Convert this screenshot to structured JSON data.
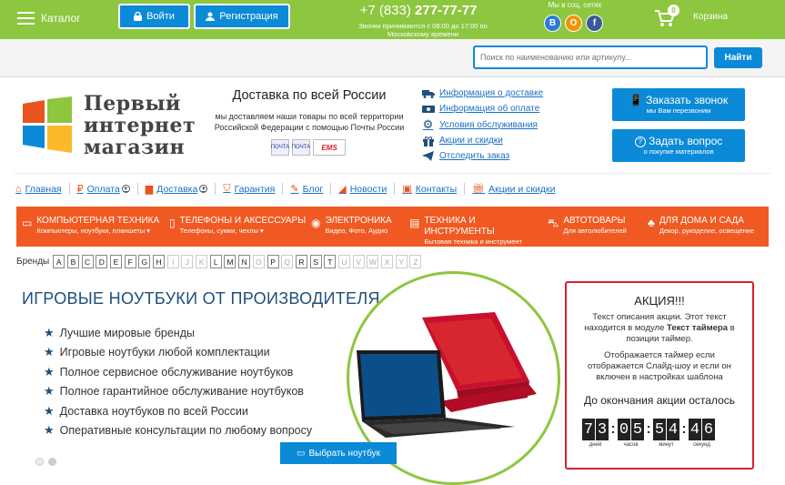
{
  "topbar": {
    "catalog": "Каталог",
    "login": "Войти",
    "register": "Регистрация",
    "phone_prefix": "+7 (833)",
    "phone_number": "277-77-77",
    "phone_note": "Звонки принимаются с 08:00 до 17:00 по Московскому времени",
    "social_label": "Мы в соц. сетях",
    "social": [
      "В",
      "О",
      "f"
    ],
    "cart_count": "0",
    "cart_label": "Корзина"
  },
  "search": {
    "placeholder": "Поиск по наименованию или артикулу...",
    "button": "Найти"
  },
  "logo": {
    "line1": "Первый",
    "line2": "интернет",
    "line3": "магазин",
    "colors": [
      "#e9541e",
      "#8dc63f",
      "#0b8ad8",
      "#fbb829"
    ]
  },
  "delivery": {
    "title": "Доставка по всей России",
    "text": "мы доставляем наши товары по всей территории Российской Федерации с помощью Почты России",
    "post1": "ПОЧТА",
    "post2": "ПОЧТА",
    "post3": "EMS"
  },
  "info_links": [
    {
      "icon": "truck-icon",
      "label": "Информация о доставке"
    },
    {
      "icon": "money-icon",
      "label": "Информация об оплате"
    },
    {
      "icon": "gear-icon",
      "label": "Условия обслуживания"
    },
    {
      "icon": "gift-icon",
      "label": "Акции и скидки"
    },
    {
      "icon": "send-icon",
      "label": "Отследить заказ"
    }
  ],
  "buttons": {
    "call_title": "Заказать звонок",
    "call_sub": "мы Вам перезвоним",
    "ask_title": "Задать вопрос",
    "ask_sub": "о покупке материалов"
  },
  "top_menu": [
    {
      "label": "Главная",
      "icon": "home-icon",
      "dropdown": false
    },
    {
      "label": "Оплата",
      "icon": "ruble-icon",
      "dropdown": true
    },
    {
      "label": "Доставка",
      "icon": "truck-icon",
      "dropdown": true
    },
    {
      "label": "Гарантия",
      "icon": "shield-icon",
      "dropdown": false
    },
    {
      "label": "Блог",
      "icon": "blog-icon",
      "dropdown": false
    },
    {
      "label": "Новости",
      "icon": "rss-icon",
      "dropdown": false
    },
    {
      "label": "Контакты",
      "icon": "contacts-icon",
      "dropdown": false
    },
    {
      "label": "Акции и скидки",
      "icon": "gift-icon",
      "dropdown": false
    }
  ],
  "categories": [
    {
      "title": "КОМПЬЮТЕРНАЯ ТЕХНИКА",
      "sub": "Компьютеры, ноутбуки, планшеты",
      "icon": "monitor-icon",
      "dropdown": true
    },
    {
      "title": "ТЕЛЕФОНЫ И АКСЕССУАРЫ",
      "sub": "Телефоны, сумки, чехлы",
      "icon": "phone-icon",
      "dropdown": true
    },
    {
      "title": "ЭЛЕКТРОНИКА",
      "sub": "Видео, Фото, Аудио",
      "icon": "camera-icon",
      "dropdown": false
    },
    {
      "title": "ТЕХНИКА И ИНСТРУМЕНТЫ",
      "sub": "Бытовая техника и инструмент",
      "icon": "tools-icon",
      "dropdown": false
    },
    {
      "title": "АВТОТОВАРЫ",
      "sub": "Для автолюбителей",
      "icon": "car-icon",
      "dropdown": false
    },
    {
      "title": "ДЛЯ ДОМА И САДА",
      "sub": "Декор, рукоделие, освещение",
      "icon": "plant-icon",
      "dropdown": false
    }
  ],
  "brands": {
    "label": "Бренды",
    "letters": [
      "A",
      "B",
      "C",
      "D",
      "E",
      "F",
      "G",
      "H",
      "I",
      "J",
      "K",
      "L",
      "M",
      "N",
      "O",
      "P",
      "Q",
      "R",
      "S",
      "T",
      "U",
      "V",
      "W",
      "X",
      "Y",
      "Z"
    ],
    "dimmed": [
      "I",
      "J",
      "K",
      "O",
      "Q",
      "U",
      "V",
      "W",
      "X",
      "Y",
      "Z"
    ]
  },
  "hero": {
    "title": "ИГРОВЫЕ НОУТБУКИ ОТ ПРОИЗВОДИТЕЛЯ",
    "features": [
      "Лучшие мировые бренды",
      "Игровые ноутбуки любой комплектации",
      "Полное сервисное обслуживание ноутбуков",
      "Полное гарантийное обслуживание ноутбуков",
      "Доставка ноутбуков по всей России",
      "Оперативные консультации по любому вопросу"
    ],
    "button": "Выбрать ноутбук"
  },
  "promo": {
    "title": "АКЦИЯ!!!",
    "text_before": "Текст описания акции. Этот текст находится в модуле ",
    "text_bold": "Текст таймера",
    "text_after": " в позиции таймер.",
    "text2": "Отображается таймер если отображается Слайд-шоу и если он включен в настройках шаблона",
    "timer_label": "До окончания акции осталось",
    "timer": [
      {
        "digits": [
          "7",
          "3"
        ],
        "caption": "дней"
      },
      {
        "digits": [
          "0",
          "5"
        ],
        "caption": "часов"
      },
      {
        "digits": [
          "5",
          "4"
        ],
        "caption": "минут"
      },
      {
        "digits": [
          "4",
          "6"
        ],
        "caption": "секунд"
      }
    ]
  }
}
